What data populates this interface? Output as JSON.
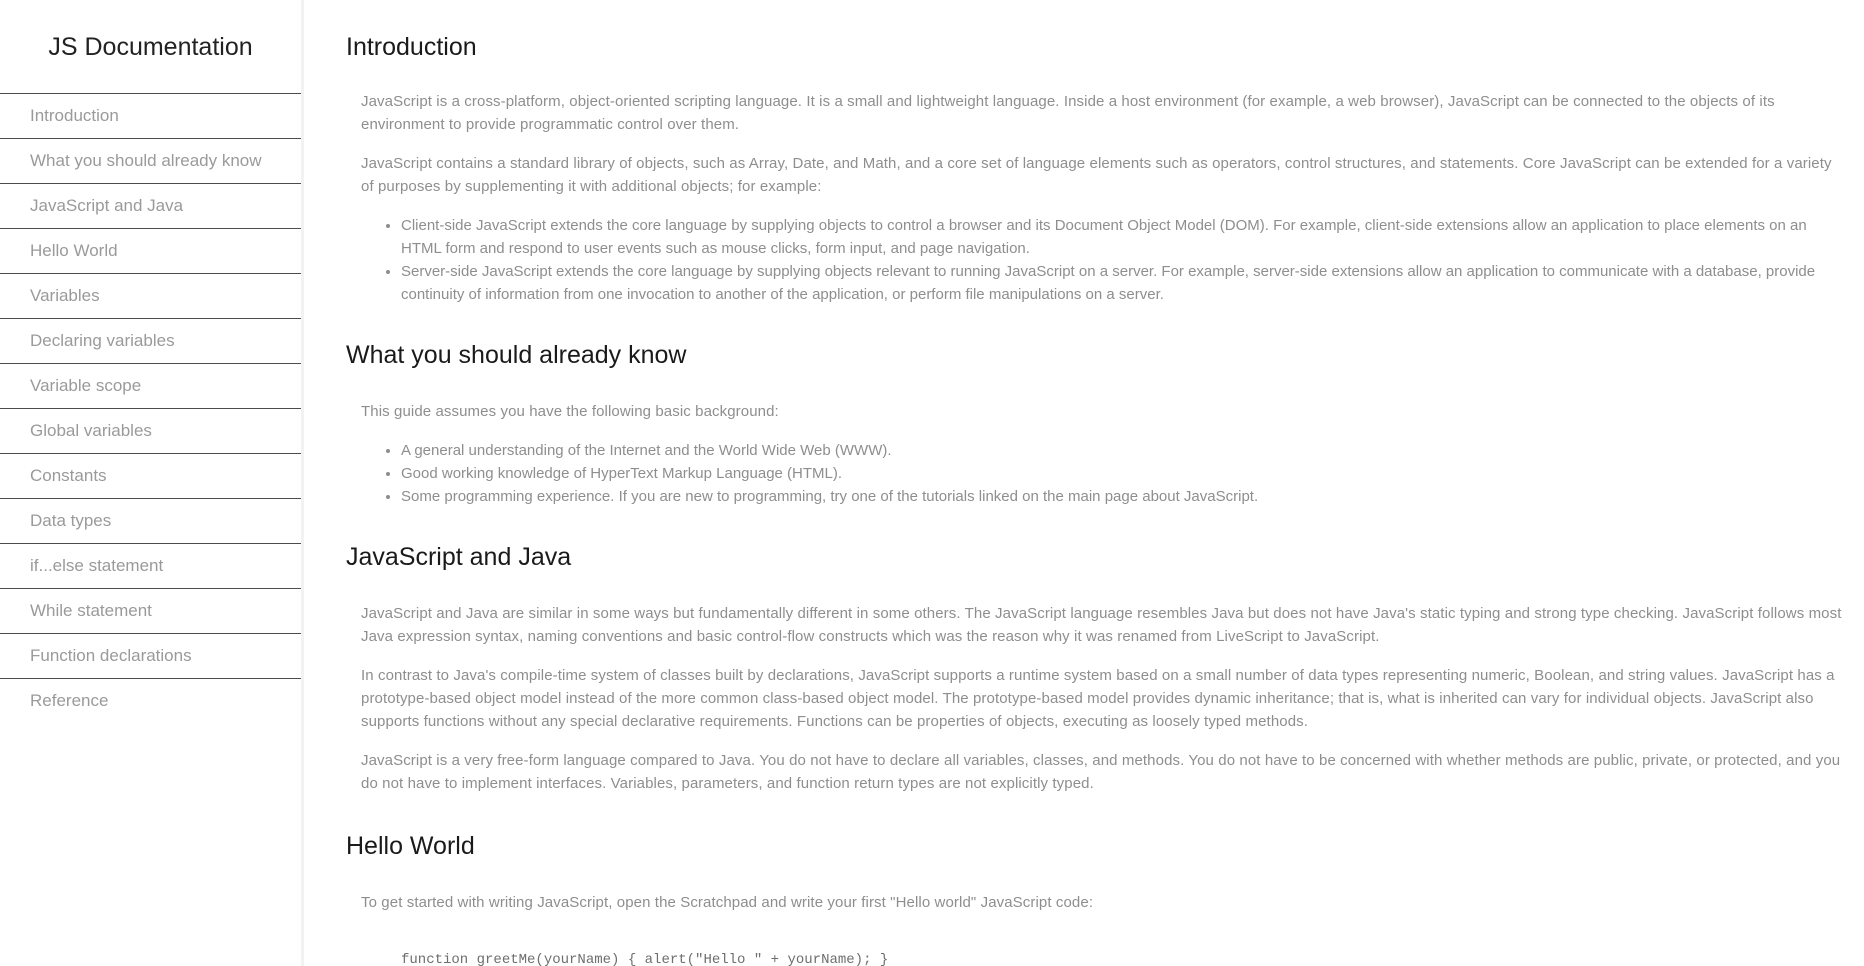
{
  "navbar": {
    "title": "JS Documentation",
    "links": [
      "Introduction",
      "What you should already know",
      "JavaScript and Java",
      "Hello World",
      "Variables",
      "Declaring variables",
      "Variable scope",
      "Global variables",
      "Constants",
      "Data types",
      "if...else statement",
      "While statement",
      "Function declarations",
      "Reference"
    ]
  },
  "main": {
    "introduction": {
      "title": "Introduction",
      "p1": "JavaScript is a cross-platform, object-oriented scripting language. It is a small and lightweight language. Inside a host environment (for example, a web browser), JavaScript can be connected to the objects of its environment to provide programmatic control over them.",
      "p2": "JavaScript contains a standard library of objects, such as Array, Date, and Math, and a core set of language elements such as operators, control structures, and statements. Core JavaScript can be extended for a variety of purposes by supplementing it with additional objects; for example:",
      "bullets": [
        "Client-side JavaScript extends the core language by supplying objects to control a browser and its Document Object Model (DOM). For example, client-side extensions allow an application to place elements on an HTML form and respond to user events such as mouse clicks, form input, and page navigation.",
        "Server-side JavaScript extends the core language by supplying objects relevant to running JavaScript on a server. For example, server-side extensions allow an application to communicate with a database, provide continuity of information from one invocation to another of the application, or perform file manipulations on a server."
      ]
    },
    "already_know": {
      "title": "What you should already know",
      "p1": "This guide assumes you have the following basic background:",
      "bullets": [
        "A general understanding of the Internet and the World Wide Web (WWW).",
        "Good working knowledge of HyperText Markup Language (HTML).",
        "Some programming experience. If you are new to programming, try one of the tutorials linked on the main page about JavaScript."
      ]
    },
    "js_and_java": {
      "title": "JavaScript and Java",
      "p1": "JavaScript and Java are similar in some ways but fundamentally different in some others. The JavaScript language resembles Java but does not have Java's static typing and strong type checking. JavaScript follows most Java expression syntax, naming conventions and basic control-flow constructs which was the reason why it was renamed from LiveScript to JavaScript.",
      "p2": "In contrast to Java's compile-time system of classes built by declarations, JavaScript supports a runtime system based on a small number of data types representing numeric, Boolean, and string values. JavaScript has a prototype-based object model instead of the more common class-based object model. The prototype-based model provides dynamic inheritance; that is, what is inherited can vary for individual objects. JavaScript also supports functions without any special declarative requirements. Functions can be properties of objects, executing as loosely typed methods.",
      "p3": "JavaScript is a very free-form language compared to Java. You do not have to declare all variables, classes, and methods. You do not have to be concerned with whether methods are public, private, or protected, and you do not have to implement interfaces. Variables, parameters, and function return types are not explicitly typed."
    },
    "hello_world": {
      "title": "Hello World",
      "p1": "To get started with writing JavaScript, open the Scratchpad and write your first \"Hello world\" JavaScript code:",
      "code": "function greetMe(yourName) { alert(\"Hello \" + yourName); }"
    }
  }
}
